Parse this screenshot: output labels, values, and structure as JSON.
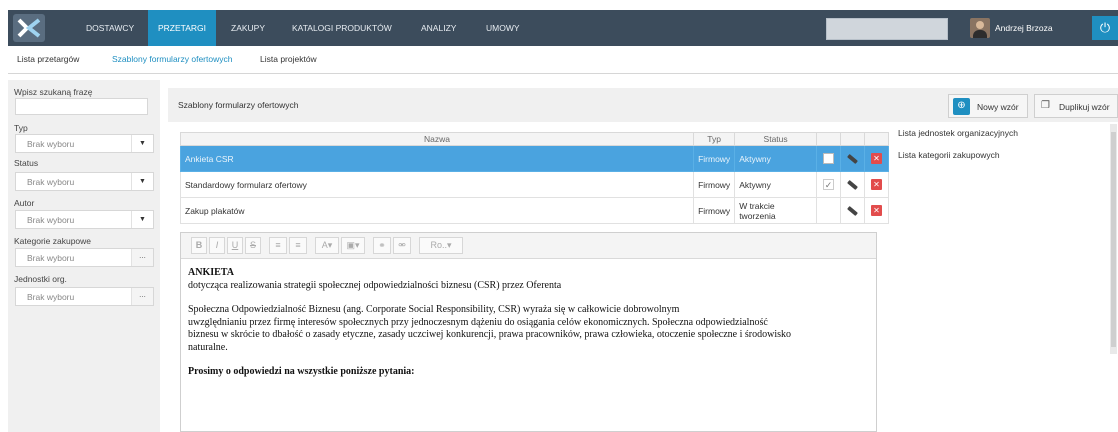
{
  "nav": {
    "items": [
      "DOSTAWCY",
      "PRZETARGI",
      "ZAKUPY",
      "KATALOGI PRODUKTÓW",
      "ANALIZY",
      "UMOWY"
    ],
    "active": "PRZETARGI",
    "user_name": "Andrzej Brzoza"
  },
  "subtabs": [
    "Lista przetargów",
    "Szablony formularzy ofertowych",
    "Lista projektów"
  ],
  "filters": {
    "search_label": "Wpisz szukaną frazę",
    "search_value": "",
    "typ_label": "Typ",
    "typ_value": "Brak wyboru",
    "status_label": "Status",
    "status_value": "Brak wyboru",
    "autor_label": "Autor",
    "autor_value": "Brak wyboru",
    "kategorie_label": "Kategorie zakupowe",
    "kategorie_value": "Brak wyboru",
    "jednostki_label": "Jednostki org.",
    "jednostki_value": "Brak wyboru",
    "picker_dots": "..."
  },
  "main": {
    "title": "Szablony formularzy ofertowych",
    "new_button": "Nowy wzór",
    "duplicate_button": "Duplikuj wzór"
  },
  "table": {
    "headers": [
      "Nazwa",
      "Typ",
      "Status"
    ],
    "rows": [
      {
        "name": "Ankieta CSR",
        "type": "Firmowy",
        "status": "Aktywny",
        "selected": true
      },
      {
        "name": "Standardowy formularz ofertowy",
        "type": "Firmowy",
        "status": "Aktywny",
        "selected": false
      },
      {
        "name": "Zakup plakatów",
        "type": "Firmowy",
        "status": "W trakcie tworzenia",
        "selected": false
      }
    ]
  },
  "editor": {
    "toolbar": [
      "B",
      "I",
      "U",
      "S",
      "≡",
      "≡",
      "A▾",
      "▣▾",
      "⚭",
      "⚮",
      "Ro..▾"
    ],
    "heading": "ANKIETA",
    "subtitle": "dotycząca realizowania strategii społecznej odpowiedzialności biznesu (CSR) przez Oferenta",
    "para1": "Społeczna Odpowiedzialność Biznesu (ang. Corporate Social Responsibility, CSR) wyraża się w całkowicie dobrowolnym",
    "para2": "uwzględnianiu przez firmę interesów społecznych przy jednoczesnym dążeniu do osiągania celów ekonomicznych. Społeczna odpowiedzialność",
    "para3": "biznesu w skrócie to dbałość o zasady etyczne, zasady uczciwej konkurencji, prawa pracowników, prawa człowieka, otoczenie społeczne i środowisko",
    "para4": "naturalne.",
    "closing": "Prosimy o odpowiedzi na wszystkie poniższe pytania:"
  },
  "right_links": [
    "Lista jednostek organizacyjnych",
    "Lista kategorii zakupowych"
  ]
}
